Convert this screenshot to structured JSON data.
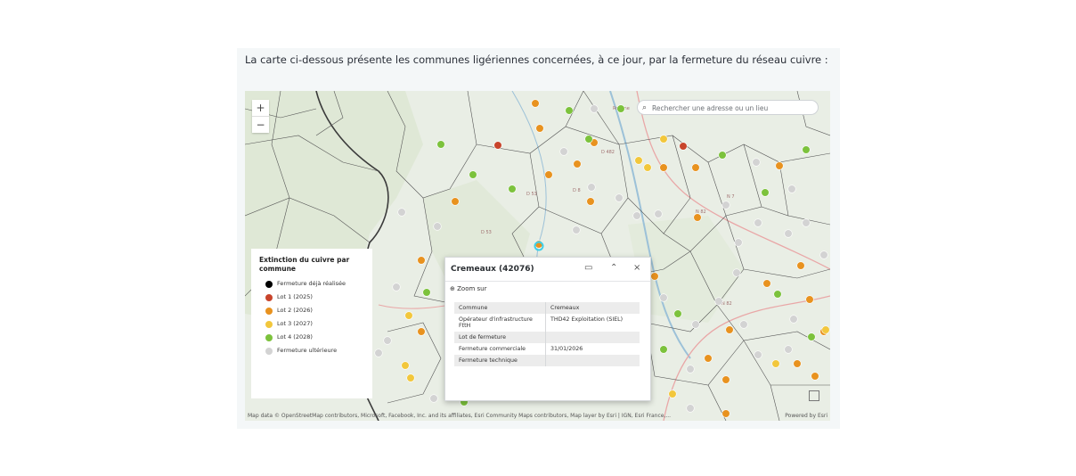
{
  "intro": "La carte ci-dessous présente les communes ligériennes concernées, à ce jour, par la fermeture du réseau cuivre :",
  "map": {
    "zoom_in": "+",
    "zoom_out": "−",
    "search_placeholder": "Rechercher une adresse ou un lieu",
    "attribution": "Map data © OpenStreetMap contributors, Microsoft, Facebook, Inc. and its affiliates, Esri Community Maps contributors, Map layer by Esri | IGN, Esri France,...",
    "powered_by": "Powered by Esri",
    "labels": [
      "Roanne",
      "D 53",
      "D 8",
      "D 53",
      "D 482",
      "N 7",
      "N 82",
      "N 82"
    ]
  },
  "legend": {
    "title": "Extinction du cuivre par commune",
    "items": [
      {
        "label": "Fermeture déjà réalisée",
        "color": "#000000"
      },
      {
        "label": "Lot 1 (2025)",
        "color": "#c8442b"
      },
      {
        "label": "Lot 2 (2026)",
        "color": "#e8921f"
      },
      {
        "label": "Lot 3 (2027)",
        "color": "#f2c73c"
      },
      {
        "label": "Lot 4 (2028)",
        "color": "#7cc23c"
      },
      {
        "label": "Fermeture ultérieure",
        "color": "#d3d3d3"
      }
    ]
  },
  "popup": {
    "title": "Cremeaux (42076)",
    "zoom_to": "Zoom sur",
    "rows": [
      {
        "key": "Commune",
        "value": "Cremeaux"
      },
      {
        "key": "Opérateur d'infrastructure FttH",
        "value": "THD42 Exploitation (SIEL)"
      },
      {
        "key": "Lot de fermeture",
        "value": ""
      },
      {
        "key": "Fermeture commerciale",
        "value": "31/01/2026"
      },
      {
        "key": "Fermeture technique",
        "value": ""
      }
    ]
  }
}
